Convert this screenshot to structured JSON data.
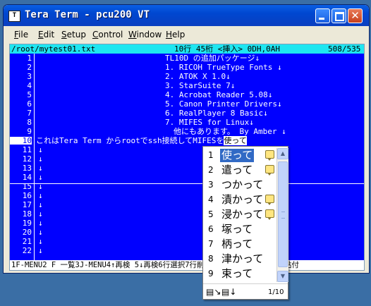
{
  "window": {
    "title": "Tera Term - pcu200 VT",
    "icon_label": "T"
  },
  "menu": [
    "File",
    "Edit",
    "Setup",
    "Control",
    "Window",
    "Help"
  ],
  "status": {
    "filename": "/root/mytest01.txt",
    "position": "10行 45桁 <挿入> 0DH,0AH",
    "count": "508/535"
  },
  "line_numbers": [
    "1",
    "2",
    "3",
    "4",
    "5",
    "6",
    "7",
    "8",
    "9",
    "10",
    "11",
    "12",
    "13",
    "14",
    "15",
    "16",
    "17",
    "18",
    "19",
    "20",
    "21",
    "22"
  ],
  "content": {
    "lines": [
      "TL10D の追加パッケージ↓",
      "1. RICOH TrueType Fonts ↓",
      "2. ATOK X 1.0↓",
      "3. StarSuite 7↓",
      "4. Acrobat Reader 5.08↓",
      "5. Canon Printer Drivers↓",
      "6. RealPlayer 8 Basic↓",
      "7. MIFES for Linux↓",
      "他にもあります。 By Amber  ↓"
    ],
    "current_line": "これはTera Term からrootでssh接続してMIFESを",
    "current_conversion": "使って",
    "arrow": "↓"
  },
  "function_bar": "1F-MENU2 F 一覧3J-MENU4↑再検  5↓再検6行選択7行削除8行コピー9行貼付0文貼付",
  "ime": {
    "candidates": [
      {
        "num": "1",
        "word": "使って",
        "memo": true
      },
      {
        "num": "2",
        "word": "遣って",
        "memo": true
      },
      {
        "num": "3",
        "word": "つかって",
        "memo": false
      },
      {
        "num": "4",
        "word": "漬かって",
        "memo": true
      },
      {
        "num": "5",
        "word": "浸かって",
        "memo": true
      },
      {
        "num": "6",
        "word": "塚って",
        "memo": false
      },
      {
        "num": "7",
        "word": "柄って",
        "memo": false
      },
      {
        "num": "8",
        "word": "津かって",
        "memo": false
      },
      {
        "num": "9",
        "word": "束って",
        "memo": false
      }
    ],
    "page": "1/10",
    "footer_icons": [
      "dictionary-tool-icon",
      "list-view-icon"
    ]
  },
  "colors": {
    "terminal_bg": "#0000ff",
    "status_bg": "#1ee6f0",
    "titlebar": "#0047d0",
    "selection": "#316ac5"
  }
}
